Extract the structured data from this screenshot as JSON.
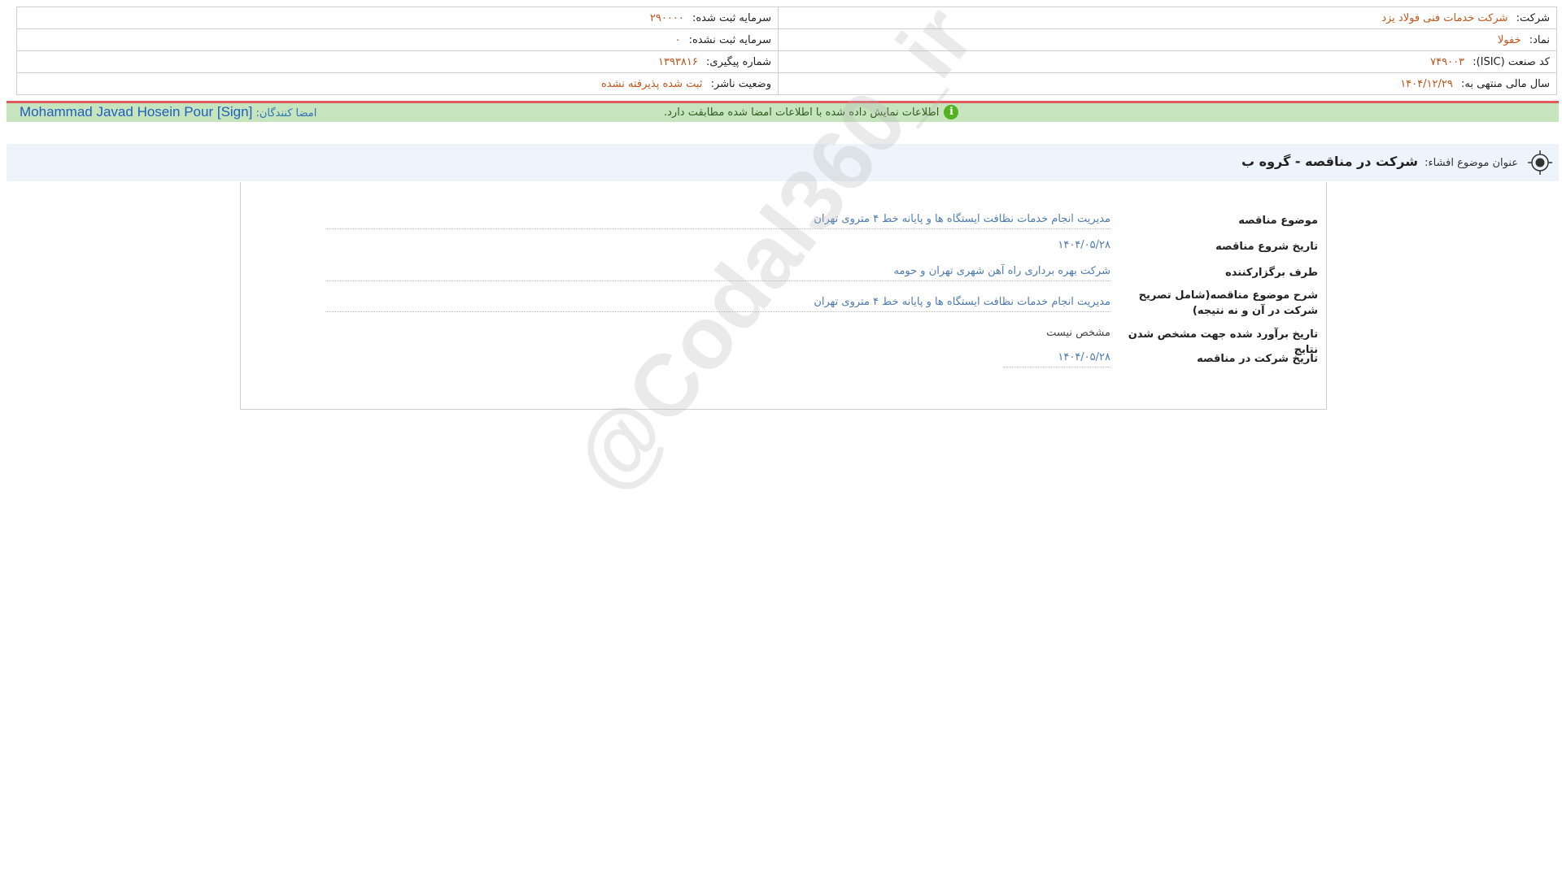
{
  "company": {
    "company_label": "شرکت:",
    "company_value": "شرکت خدمات فنی فولاد یزد",
    "registered_capital_label": "سرمایه ثبت شده:",
    "registered_capital_value": "۲۹۰۰۰۰",
    "symbol_label": "نماد:",
    "symbol_value": "خفولا",
    "unregistered_capital_label": "سرمایه ثبت نشده:",
    "unregistered_capital_value": "۰",
    "isic_label": "کد صنعت (ISIC):",
    "isic_value": "۷۴۹۰۰۳",
    "tracking_label": "شماره پیگیری:",
    "tracking_value": "۱۳۹۳۸۱۶",
    "fiscal_year_label": "سال مالی منتهی به:",
    "fiscal_year_value": "۱۴۰۴/۱۲/۲۹",
    "publisher_status_label": "وضعیت ناشر:",
    "publisher_status_value": "ثبت شده پذیرفته نشده"
  },
  "sign_bar": {
    "signers_label": "امضا کنندگان:",
    "signer_name": "Mohammad Javad Hosein Pour [Sign]",
    "match_message": "اطلاعات نمایش داده شده با اطلاعات امضا شده مطابقت دارد.",
    "info_icon_glyph": "i"
  },
  "subject": {
    "label": "عنوان موضوع افشاء:",
    "value": "شرکت در مناقصه - گروه ب"
  },
  "details": [
    {
      "label": "موضوع مناقصه",
      "value": "مدیریت انجام خدمات نظافت ایستگاه ها و پایانه خط ۴ متروی تهران"
    },
    {
      "label": "تاریخ شروع مناقصه",
      "value": "۱۴۰۴/۰۵/۲۸"
    },
    {
      "label": "طرف برگزارکننده",
      "value": "شرکت بهره برداری راه آهن شهری تهران و حومه"
    },
    {
      "label": "شرح موضوع مناقصه(شامل تصریح شرکت در آن و نه نتیجه)",
      "value": "مدیریت انجام خدمات نظافت ایستگاه ها و پایانه خط ۴ متروی تهران"
    },
    {
      "label": "تاریخ برآورد شده جهت مشخص شدن نتایج",
      "value": "مشخص نیست"
    },
    {
      "label": "تاریخ شرکت در مناقصه",
      "value": "۱۴۰۴/۰۵/۲۸"
    }
  ],
  "watermark": "@Codal360_ir",
  "icons": {
    "info": "info-circle-icon",
    "target": "crosshair-target-icon"
  },
  "colors": {
    "value_orange": "#c0551b",
    "value_blue": "#4d7bb0",
    "sign_bg": "#c6e4bd",
    "sign_border": "#e05c5c"
  }
}
